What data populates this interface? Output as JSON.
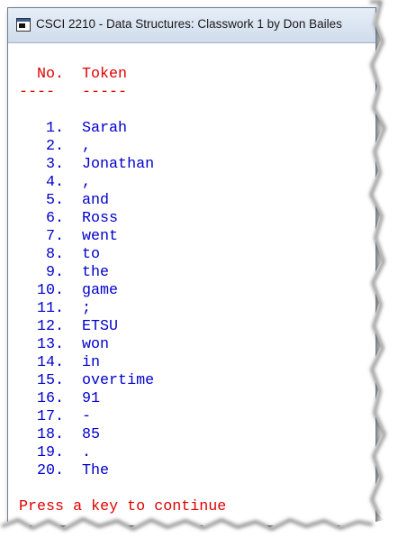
{
  "window": {
    "title": "CSCI 2210 - Data Structures: Classwork 1 by Don Bailes"
  },
  "console": {
    "header_no": "No.",
    "header_token": "Token",
    "underline_no": "----",
    "underline_token": "-----",
    "rows": [
      {
        "n": "1.",
        "t": "Sarah"
      },
      {
        "n": "2.",
        "t": ","
      },
      {
        "n": "3.",
        "t": "Jonathan"
      },
      {
        "n": "4.",
        "t": ","
      },
      {
        "n": "5.",
        "t": "and"
      },
      {
        "n": "6.",
        "t": "Ross"
      },
      {
        "n": "7.",
        "t": "went"
      },
      {
        "n": "8.",
        "t": "to"
      },
      {
        "n": "9.",
        "t": "the"
      },
      {
        "n": "10.",
        "t": "game"
      },
      {
        "n": "11.",
        "t": ";"
      },
      {
        "n": "12.",
        "t": "ETSU"
      },
      {
        "n": "13.",
        "t": "won"
      },
      {
        "n": "14.",
        "t": "in"
      },
      {
        "n": "15.",
        "t": "overtime"
      },
      {
        "n": "16.",
        "t": "91"
      },
      {
        "n": "17.",
        "t": "-"
      },
      {
        "n": "18.",
        "t": "85"
      },
      {
        "n": "19.",
        "t": "."
      },
      {
        "n": "20.",
        "t": "The"
      }
    ],
    "prompt": "Press a key to continue"
  },
  "colors": {
    "header": "#e00000",
    "text": "#0000cc",
    "background": "#ffffff"
  },
  "icons": {
    "window_icon": "console-window-icon"
  }
}
